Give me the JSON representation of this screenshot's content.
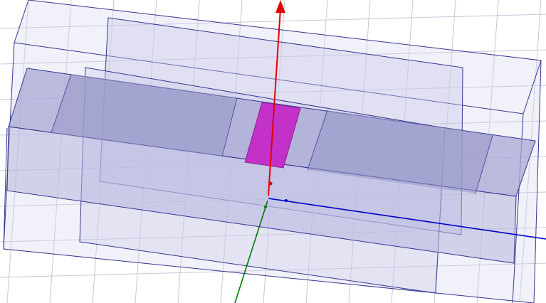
{
  "viewport": {
    "background": "#ffffff",
    "grid_color": "#c6c6d8",
    "solid_fill": "#b4b4dc",
    "solid_edge": "#353590",
    "highlight_color": "#c431c9"
  },
  "axes": {
    "z_axis_color": "#e00000",
    "x_axis_color": "#0000c8",
    "y_axis_color": "#007a00",
    "labels_visible": false
  },
  "selection": {
    "highlighted_face": "magenta patch"
  }
}
